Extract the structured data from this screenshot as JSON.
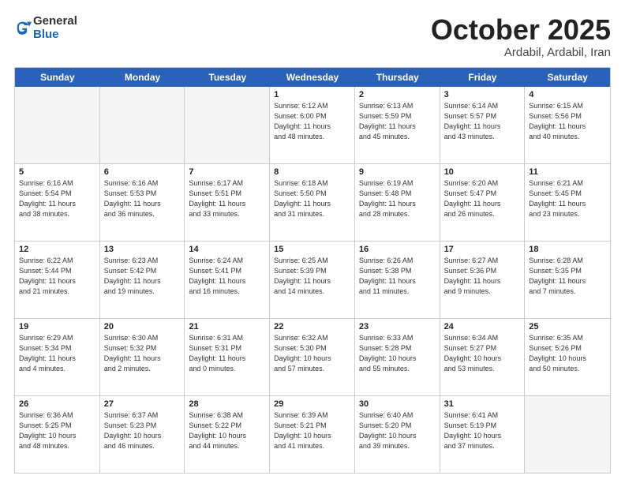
{
  "header": {
    "logo_general": "General",
    "logo_blue": "Blue",
    "month_title": "October 2025",
    "location": "Ardabil, Ardabil, Iran"
  },
  "weekdays": [
    "Sunday",
    "Monday",
    "Tuesday",
    "Wednesday",
    "Thursday",
    "Friday",
    "Saturday"
  ],
  "rows": [
    [
      {
        "day": "",
        "info": ""
      },
      {
        "day": "",
        "info": ""
      },
      {
        "day": "",
        "info": ""
      },
      {
        "day": "1",
        "info": "Sunrise: 6:12 AM\nSunset: 6:00 PM\nDaylight: 11 hours\nand 48 minutes."
      },
      {
        "day": "2",
        "info": "Sunrise: 6:13 AM\nSunset: 5:59 PM\nDaylight: 11 hours\nand 45 minutes."
      },
      {
        "day": "3",
        "info": "Sunrise: 6:14 AM\nSunset: 5:57 PM\nDaylight: 11 hours\nand 43 minutes."
      },
      {
        "day": "4",
        "info": "Sunrise: 6:15 AM\nSunset: 5:56 PM\nDaylight: 11 hours\nand 40 minutes."
      }
    ],
    [
      {
        "day": "5",
        "info": "Sunrise: 6:16 AM\nSunset: 5:54 PM\nDaylight: 11 hours\nand 38 minutes."
      },
      {
        "day": "6",
        "info": "Sunrise: 6:16 AM\nSunset: 5:53 PM\nDaylight: 11 hours\nand 36 minutes."
      },
      {
        "day": "7",
        "info": "Sunrise: 6:17 AM\nSunset: 5:51 PM\nDaylight: 11 hours\nand 33 minutes."
      },
      {
        "day": "8",
        "info": "Sunrise: 6:18 AM\nSunset: 5:50 PM\nDaylight: 11 hours\nand 31 minutes."
      },
      {
        "day": "9",
        "info": "Sunrise: 6:19 AM\nSunset: 5:48 PM\nDaylight: 11 hours\nand 28 minutes."
      },
      {
        "day": "10",
        "info": "Sunrise: 6:20 AM\nSunset: 5:47 PM\nDaylight: 11 hours\nand 26 minutes."
      },
      {
        "day": "11",
        "info": "Sunrise: 6:21 AM\nSunset: 5:45 PM\nDaylight: 11 hours\nand 23 minutes."
      }
    ],
    [
      {
        "day": "12",
        "info": "Sunrise: 6:22 AM\nSunset: 5:44 PM\nDaylight: 11 hours\nand 21 minutes."
      },
      {
        "day": "13",
        "info": "Sunrise: 6:23 AM\nSunset: 5:42 PM\nDaylight: 11 hours\nand 19 minutes."
      },
      {
        "day": "14",
        "info": "Sunrise: 6:24 AM\nSunset: 5:41 PM\nDaylight: 11 hours\nand 16 minutes."
      },
      {
        "day": "15",
        "info": "Sunrise: 6:25 AM\nSunset: 5:39 PM\nDaylight: 11 hours\nand 14 minutes."
      },
      {
        "day": "16",
        "info": "Sunrise: 6:26 AM\nSunset: 5:38 PM\nDaylight: 11 hours\nand 11 minutes."
      },
      {
        "day": "17",
        "info": "Sunrise: 6:27 AM\nSunset: 5:36 PM\nDaylight: 11 hours\nand 9 minutes."
      },
      {
        "day": "18",
        "info": "Sunrise: 6:28 AM\nSunset: 5:35 PM\nDaylight: 11 hours\nand 7 minutes."
      }
    ],
    [
      {
        "day": "19",
        "info": "Sunrise: 6:29 AM\nSunset: 5:34 PM\nDaylight: 11 hours\nand 4 minutes."
      },
      {
        "day": "20",
        "info": "Sunrise: 6:30 AM\nSunset: 5:32 PM\nDaylight: 11 hours\nand 2 minutes."
      },
      {
        "day": "21",
        "info": "Sunrise: 6:31 AM\nSunset: 5:31 PM\nDaylight: 11 hours\nand 0 minutes."
      },
      {
        "day": "22",
        "info": "Sunrise: 6:32 AM\nSunset: 5:30 PM\nDaylight: 10 hours\nand 57 minutes."
      },
      {
        "day": "23",
        "info": "Sunrise: 6:33 AM\nSunset: 5:28 PM\nDaylight: 10 hours\nand 55 minutes."
      },
      {
        "day": "24",
        "info": "Sunrise: 6:34 AM\nSunset: 5:27 PM\nDaylight: 10 hours\nand 53 minutes."
      },
      {
        "day": "25",
        "info": "Sunrise: 6:35 AM\nSunset: 5:26 PM\nDaylight: 10 hours\nand 50 minutes."
      }
    ],
    [
      {
        "day": "26",
        "info": "Sunrise: 6:36 AM\nSunset: 5:25 PM\nDaylight: 10 hours\nand 48 minutes."
      },
      {
        "day": "27",
        "info": "Sunrise: 6:37 AM\nSunset: 5:23 PM\nDaylight: 10 hours\nand 46 minutes."
      },
      {
        "day": "28",
        "info": "Sunrise: 6:38 AM\nSunset: 5:22 PM\nDaylight: 10 hours\nand 44 minutes."
      },
      {
        "day": "29",
        "info": "Sunrise: 6:39 AM\nSunset: 5:21 PM\nDaylight: 10 hours\nand 41 minutes."
      },
      {
        "day": "30",
        "info": "Sunrise: 6:40 AM\nSunset: 5:20 PM\nDaylight: 10 hours\nand 39 minutes."
      },
      {
        "day": "31",
        "info": "Sunrise: 6:41 AM\nSunset: 5:19 PM\nDaylight: 10 hours\nand 37 minutes."
      },
      {
        "day": "",
        "info": ""
      }
    ]
  ]
}
